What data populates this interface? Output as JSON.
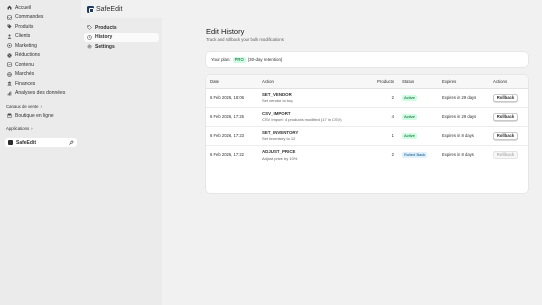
{
  "admin_nav": {
    "items": [
      {
        "label": "Accueil",
        "icon": "home-icon"
      },
      {
        "label": "Commandes",
        "icon": "inbox-icon"
      },
      {
        "label": "Produits",
        "icon": "tag-icon"
      },
      {
        "label": "Clients",
        "icon": "person-icon"
      },
      {
        "label": "Marketing",
        "icon": "target-icon"
      },
      {
        "label": "Réductions",
        "icon": "discount-icon"
      },
      {
        "label": "Contenu",
        "icon": "content-icon"
      },
      {
        "label": "Marchés",
        "icon": "globe-icon"
      },
      {
        "label": "Finances",
        "icon": "bank-icon"
      },
      {
        "label": "Analyses des données",
        "icon": "chart-icon"
      }
    ],
    "sales_channels_label": "Canaux de vente",
    "online_store_label": "Boutique en ligne",
    "apps_label": "Applications",
    "app_item_label": "SafeEdit"
  },
  "app": {
    "brand": "SafeEdit",
    "nav": [
      {
        "label": "Products",
        "active": false
      },
      {
        "label": "History",
        "active": true
      },
      {
        "label": "Settings",
        "active": false
      }
    ]
  },
  "page": {
    "title": "Edit History",
    "subtitle": "Track and rollback your bulk modifications"
  },
  "plan": {
    "prefix": "Your plan:",
    "badge": "PRO",
    "suffix": "(30-day retention)"
  },
  "table": {
    "headers": {
      "date": "Date",
      "action": "Action",
      "products": "Products",
      "status": "Status",
      "expires": "Expires",
      "actions": "Actions"
    },
    "rows": [
      {
        "date": "6 Feb 2026, 18:06",
        "action": "SET_VENDOR",
        "desc": "Set vendor to toq",
        "products": "2",
        "status": "Active",
        "expires": "Expires in 29 days",
        "button": "Rollback"
      },
      {
        "date": "6 Feb 2026, 17:25",
        "action": "CSV_IMPORT",
        "desc": "CSV Import: 4 products modified (17 in CSV)",
        "products": "4",
        "status": "Active",
        "expires": "Expires in 29 days",
        "button": "Rollback"
      },
      {
        "date": "6 Feb 2026, 17:23",
        "action": "SET_INVENTORY",
        "desc": "Set inventory to 12",
        "products": "1",
        "status": "Active",
        "expires": "Expires in 8 days",
        "button": "Rollback"
      },
      {
        "date": "6 Feb 2026, 17:22",
        "action": "ADJUST_PRICE",
        "desc": "Adjust price by 10%",
        "products": "2",
        "status": "Rolled Back",
        "expires": "Expires in 8 days",
        "button": "Rollback"
      }
    ]
  },
  "colors": {
    "active_badge_bg": "#cdfee1",
    "rolled_back_badge_bg": "#e0f0ff",
    "brand": "#1f3a5c"
  }
}
